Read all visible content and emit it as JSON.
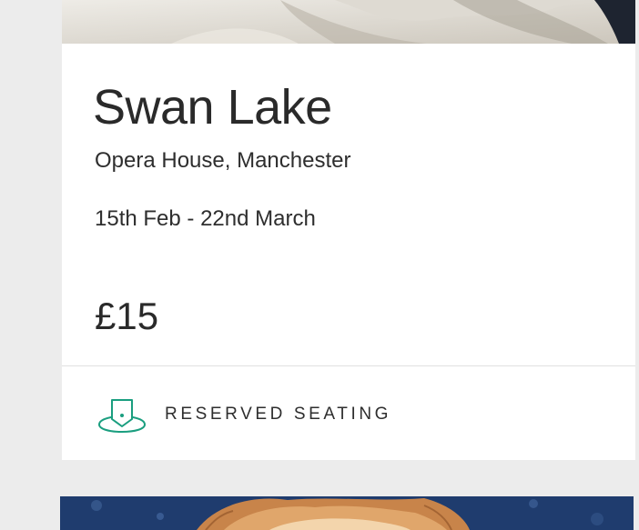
{
  "event": {
    "title": "Swan Lake",
    "venue": "Opera House, Manchester",
    "dates": "15th Feb - 22nd March",
    "price": "£15"
  },
  "seating": {
    "label": "RESERVED SEATING",
    "icon": "reserved-seat-icon"
  },
  "colors": {
    "accent": "#1a9e7f",
    "card_bg": "#ffffff",
    "page_bg": "#ececec",
    "text": "#2b2b2b",
    "divider": "#e1e1e1"
  }
}
